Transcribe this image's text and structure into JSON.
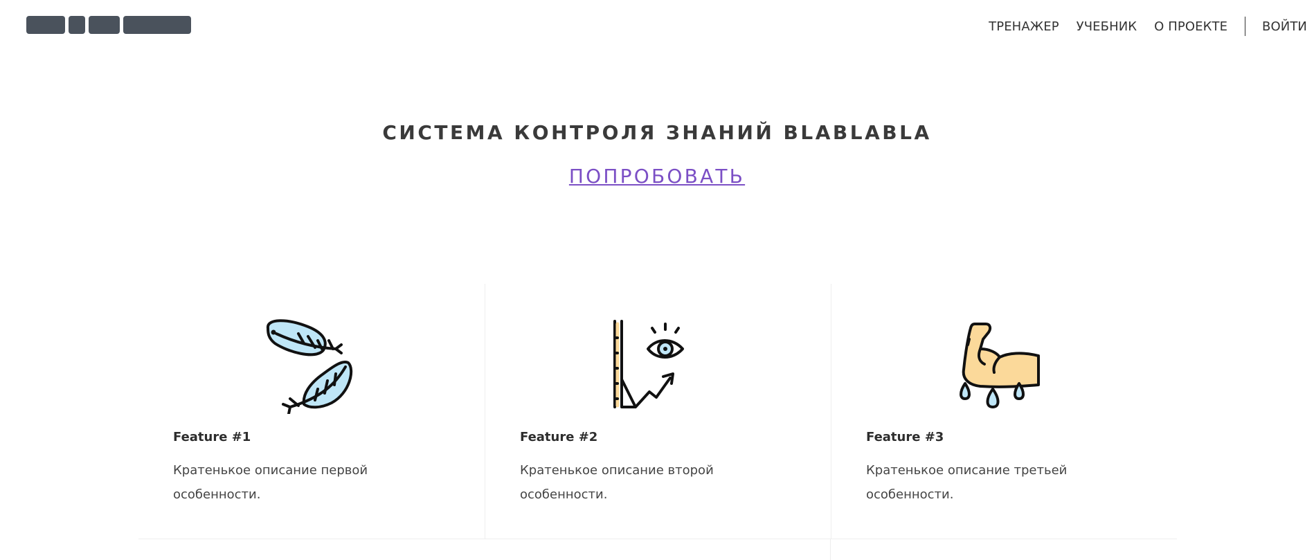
{
  "header": {
    "nav": {
      "trainer": "ТРЕНАЖЕР",
      "textbook": "УЧЕБНИК",
      "about": "О ПРОЕКТЕ",
      "login": "ВОЙТИ"
    }
  },
  "hero": {
    "title": "СИСТЕМА КОНТРОЛЯ ЗНАНИЙ BLABLABLA",
    "cta": "ПОПРОБОВАТЬ"
  },
  "features": [
    {
      "title": "Feature #1",
      "description": "Кратенькое описание первой особенности.",
      "icon": "feathers-icon"
    },
    {
      "title": "Feature #2",
      "description": "Кратенькое описание второй особенности.",
      "icon": "eye-growth-chart-icon"
    },
    {
      "title": "Feature #3",
      "description": "Кратенькое описание третьей особенности.",
      "icon": "strong-arm-sweat-icon"
    }
  ],
  "colors": {
    "accent": "#7b4fc5",
    "logo": "#4a525c",
    "text": "#333333",
    "icon_blue": "#bfe6f7",
    "icon_skin": "#fbd99a"
  }
}
